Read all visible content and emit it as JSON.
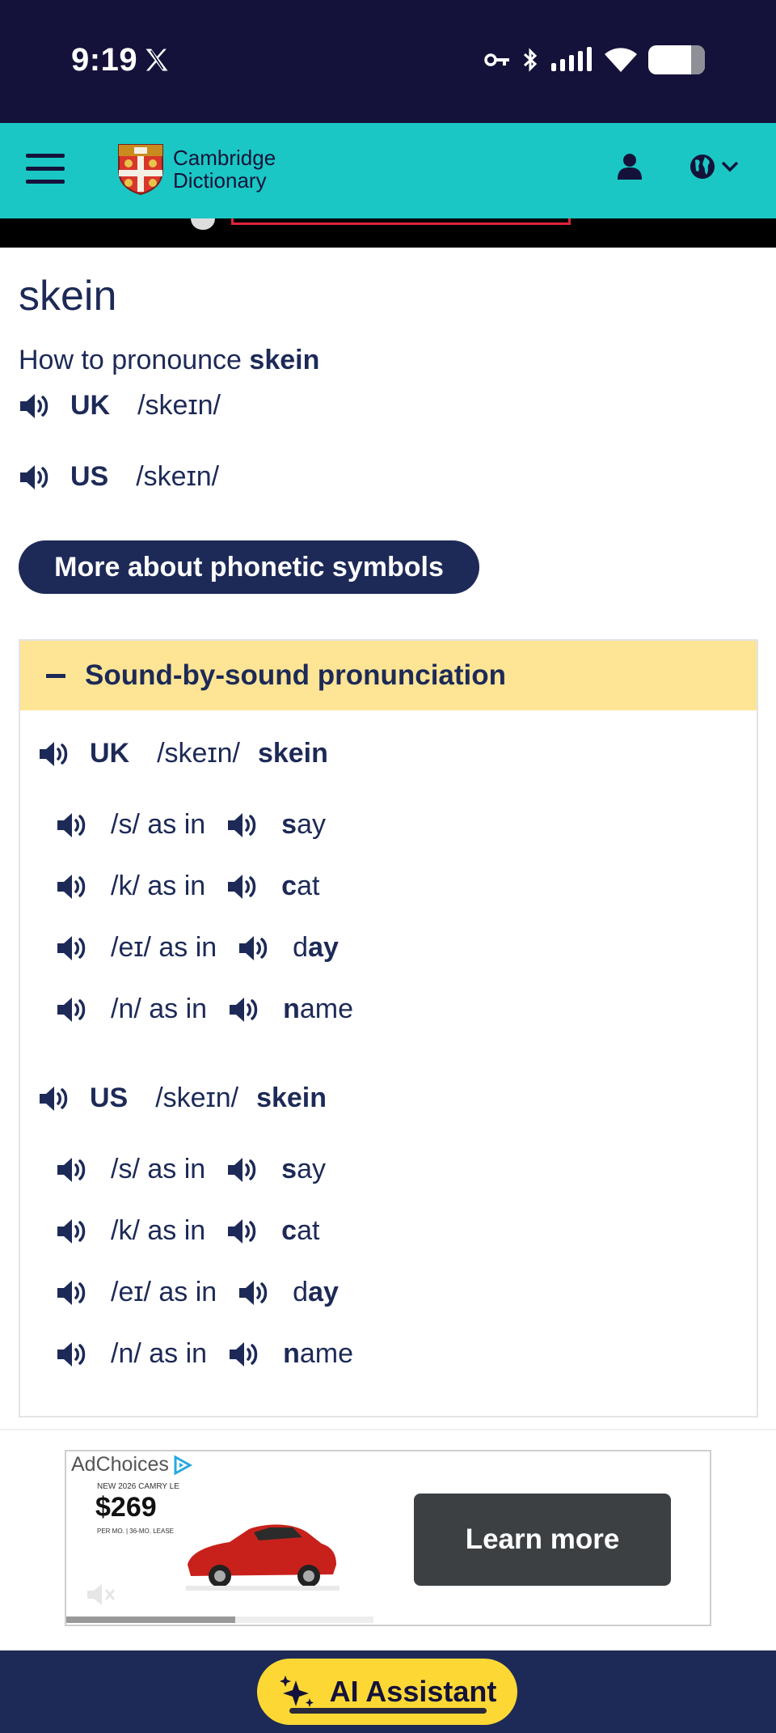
{
  "status_bar": {
    "time": "9:19",
    "battery_level": 0.75
  },
  "header": {
    "logo_line1": "Cambridge",
    "logo_line2": "Dictionary"
  },
  "entry": {
    "word": "skein",
    "how_to_prefix": "How to pronounce ",
    "how_to_word": "skein",
    "uk_label": "UK",
    "uk_ipa": "/skeɪn/",
    "us_label": "US",
    "us_ipa": "/skeɪn/",
    "phonetic_button": "More about phonetic symbols"
  },
  "sound_by_sound": {
    "heading": "Sound-by-sound pronunciation",
    "uk": {
      "label": "UK",
      "ipa": "/skeɪn/",
      "word": "skein",
      "sounds": [
        {
          "phoneme": "/s/ as in",
          "ex_bold": "s",
          "ex_rest": "ay"
        },
        {
          "phoneme": "/k/ as in",
          "ex_bold": "c",
          "ex_rest": "at"
        },
        {
          "phoneme": "/eɪ/ as in",
          "ex_pre": "d",
          "ex_bold": "ay"
        },
        {
          "phoneme": "/n/ as in",
          "ex_bold": "n",
          "ex_rest": "ame"
        }
      ]
    },
    "us": {
      "label": "US",
      "ipa": "/skeɪn/",
      "word": "skein",
      "sounds": [
        {
          "phoneme": "/s/ as in",
          "ex_bold": "s",
          "ex_rest": "ay"
        },
        {
          "phoneme": "/k/ as in",
          "ex_bold": "c",
          "ex_rest": "at"
        },
        {
          "phoneme": "/eɪ/ as in",
          "ex_pre": "d",
          "ex_bold": "ay"
        },
        {
          "phoneme": "/n/ as in",
          "ex_bold": "n",
          "ex_rest": "ame"
        }
      ]
    }
  },
  "ad": {
    "adchoices": "AdChoices",
    "model": "NEW 2026 CAMRY LE",
    "price": "$269",
    "terms": "PER MO. | 36-MO. LEASE",
    "cta": "Learn more",
    "video_progress": 0.55
  },
  "bottom": {
    "ai_button": "AI Assistant"
  },
  "colors": {
    "navy": "#1d2a57",
    "teal": "#1ac7c4",
    "yellow": "#fde595",
    "status_bg": "#14123a"
  }
}
